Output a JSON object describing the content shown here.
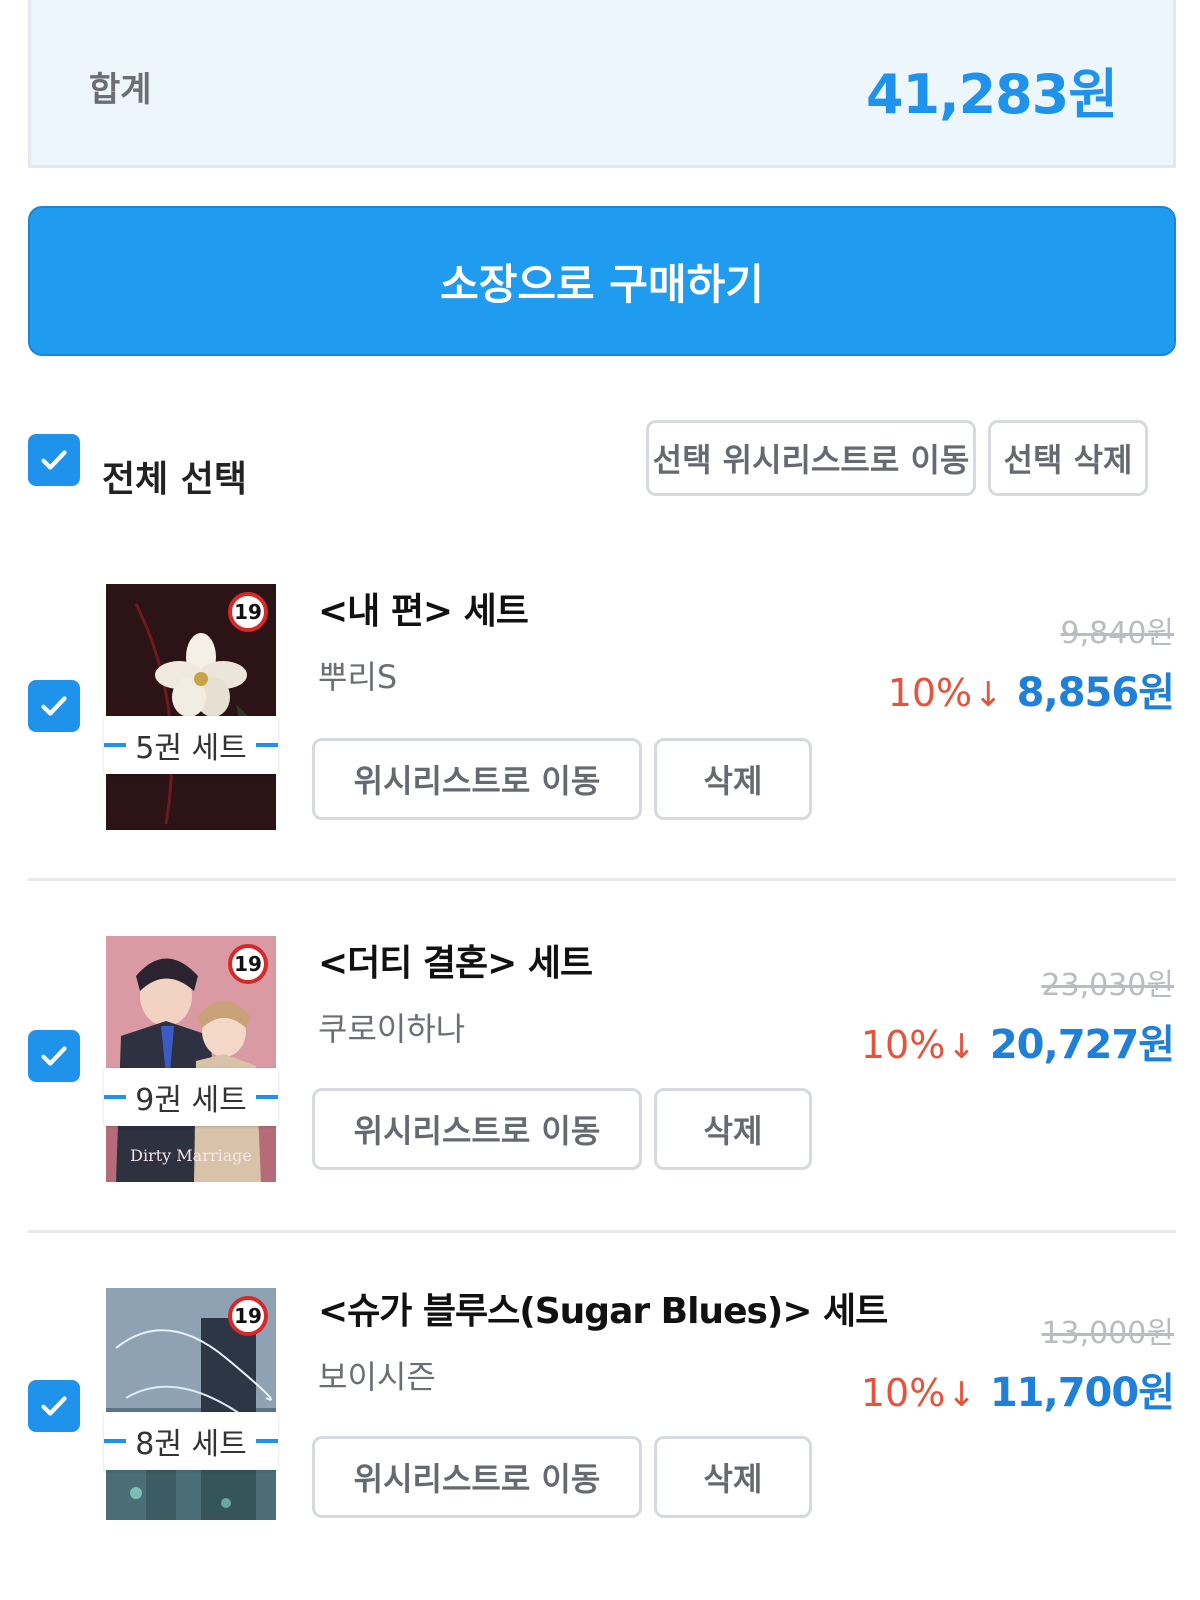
{
  "summary": {
    "total_label": "합계",
    "total_amount": "41,283원"
  },
  "buy_button_label": "소장으로 구매하기",
  "toolbar": {
    "select_all_label": "전체 선택",
    "move_selected_label": "선택 위시리스트로 이동",
    "delete_selected_label": "선택 삭제"
  },
  "items": [
    {
      "title": "<내 편> 세트",
      "author": "뿌리S",
      "set_label": "5권 세트",
      "age_badge": "19",
      "original_price": "9,840원",
      "discount": "10%",
      "sale_price": "8,856원",
      "wishlist_label": "위시리스트로 이동",
      "delete_label": "삭제",
      "checked": true
    },
    {
      "title": "<더티 결혼> 세트",
      "author": "쿠로이하나",
      "set_label": "9권 세트",
      "age_badge": "19",
      "original_price": "23,030원",
      "discount": "10%",
      "sale_price": "20,727원",
      "wishlist_label": "위시리스트로 이동",
      "delete_label": "삭제",
      "checked": true
    },
    {
      "title": "<슈가 블루스(Sugar Blues)> 세트",
      "author": "보이시즌",
      "set_label": "8권 세트",
      "age_badge": "19",
      "original_price": "13,000원",
      "discount": "10%",
      "sale_price": "11,700원",
      "wishlist_label": "위시리스트로 이동",
      "delete_label": "삭제",
      "checked": true
    }
  ],
  "colors": {
    "accent": "#1f93ec",
    "discount": "#e5533c",
    "sale_price": "#1f80d9"
  },
  "icons": {
    "checkbox": "check-icon",
    "discount_arrow": "down-arrow-icon"
  }
}
